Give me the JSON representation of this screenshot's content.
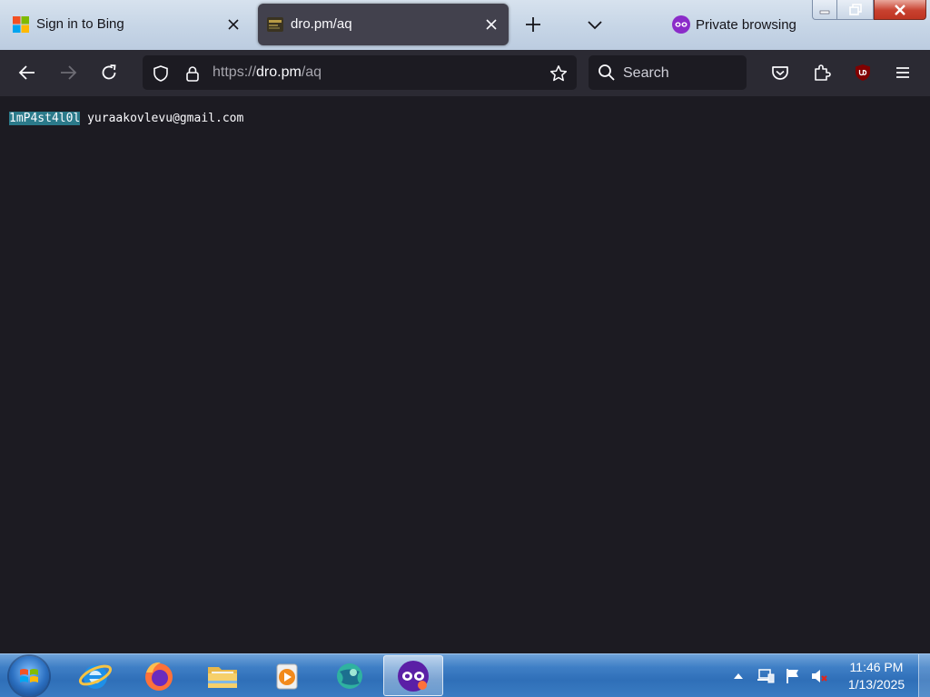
{
  "browser": {
    "tabs": [
      {
        "title": "Sign in to Bing",
        "active": false,
        "favicon": "microsoft-logo-icon"
      },
      {
        "title": "dro.pm/aq",
        "active": true,
        "favicon": "site-favicon"
      }
    ],
    "private_label": "Private browsing",
    "url": {
      "scheme": "https://",
      "host": "dro.pm",
      "path": "/aq"
    },
    "search_placeholder": "Search"
  },
  "page": {
    "selected_text": "1mP4st4l0l",
    "rest_text": " yuraakovlevu@gmail.com"
  },
  "taskbar": {
    "apps": [
      "internet-explorer-icon",
      "firefox-icon",
      "file-explorer-icon",
      "media-player-icon",
      "globe-app-icon",
      "firefox-private-icon"
    ],
    "clock": {
      "time": "11:46 PM",
      "date": "1/13/2025"
    }
  },
  "colors": {
    "toolbar": "#2b2a33",
    "content_bg": "#1c1b22",
    "selection": "#2b7a8a",
    "private_purple": "#8b2cc9"
  }
}
